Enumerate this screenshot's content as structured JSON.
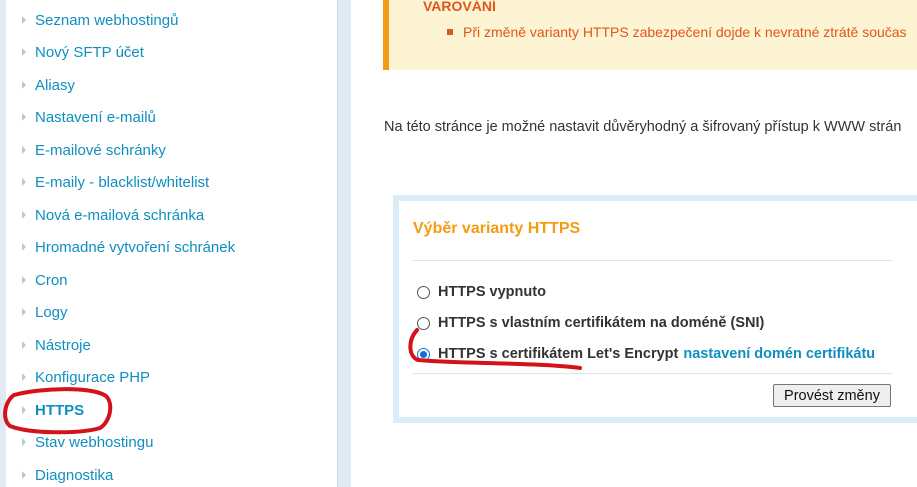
{
  "sidebar": {
    "items": [
      {
        "label": "Seznam webhostingů"
      },
      {
        "label": "Nový SFTP účet"
      },
      {
        "label": "Aliasy"
      },
      {
        "label": "Nastavení e-mailů"
      },
      {
        "label": "E-mailové schránky"
      },
      {
        "label": "E-maily - blacklist/whitelist"
      },
      {
        "label": "Nová e-mailová schránka"
      },
      {
        "label": "Hromadné vytvoření schránek"
      },
      {
        "label": "Cron"
      },
      {
        "label": "Logy"
      },
      {
        "label": "Nástroje"
      },
      {
        "label": "Konfigurace PHP"
      },
      {
        "label": "HTTPS",
        "active": true
      },
      {
        "label": "Stav webhostingu"
      },
      {
        "label": "Diagnostika"
      }
    ]
  },
  "warning": {
    "title": "VAROVÁNÍ",
    "item": "Při změně varianty HTTPS zabezpečení dojde k nevratné ztrátě součas"
  },
  "intro_text": "Na této stránce je možné nastavit důvěryhodný a šifrovaný přístup k WWW strán",
  "https_box": {
    "title": "Výběr varianty HTTPS",
    "options": [
      {
        "label": "HTTPS vypnuto",
        "checked": false
      },
      {
        "label": "HTTPS s vlastním certifikátem na doméně (SNI)",
        "checked": false
      },
      {
        "label": "HTTPS s certifikátem Let's Encrypt",
        "checked": true,
        "link": "nastavení domén certifikátu"
      }
    ],
    "submit_label": "Provést změny"
  },
  "colors": {
    "link": "#0f8fbf",
    "warning": "#e0561b",
    "accent": "#f39c12",
    "annotation": "#d4121b"
  },
  "icons": {
    "sidebar_bullet": "triangle-right-icon"
  }
}
